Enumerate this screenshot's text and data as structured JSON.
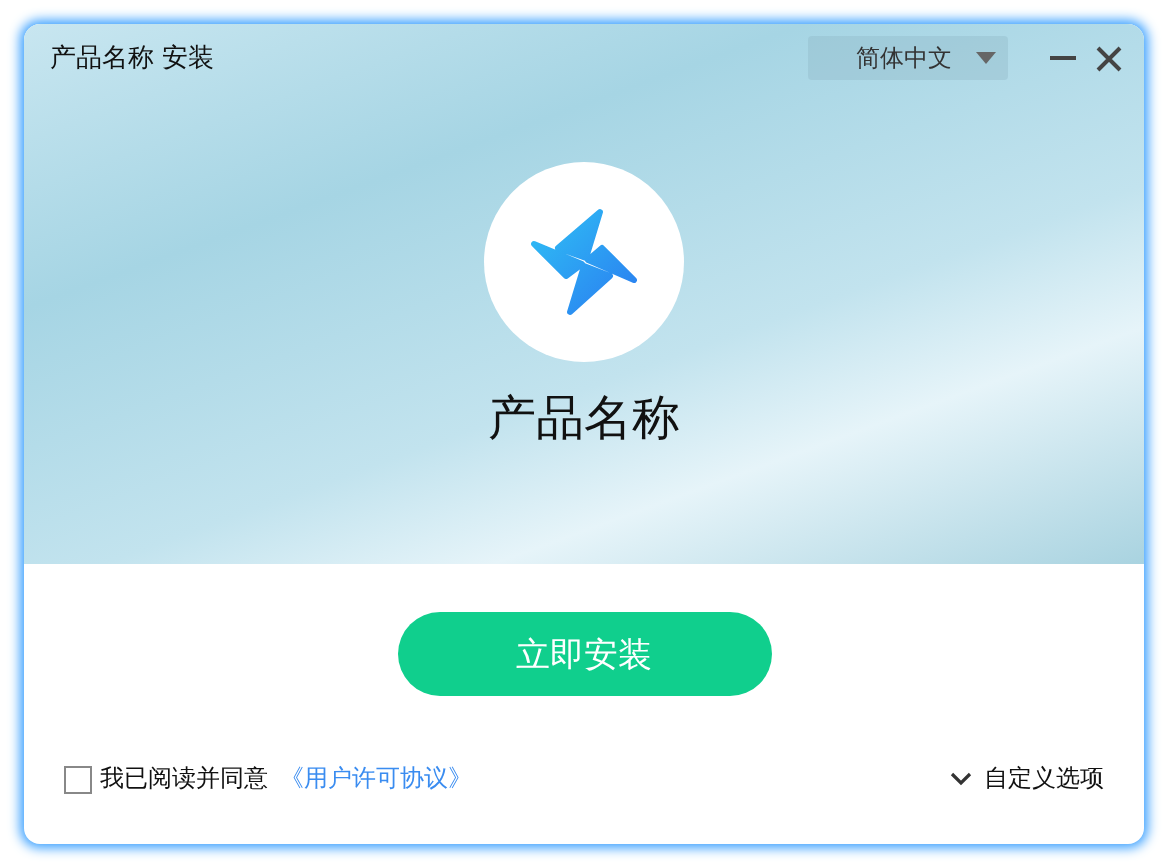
{
  "window": {
    "title": "产品名称 安装"
  },
  "language": {
    "value": "简体中文"
  },
  "product": {
    "name": "产品名称"
  },
  "install_button": "立即安装",
  "agreement": {
    "checked": false,
    "text": "我已阅读并同意",
    "link": "《用户许可协议》"
  },
  "custom_options": "自定义选项"
}
